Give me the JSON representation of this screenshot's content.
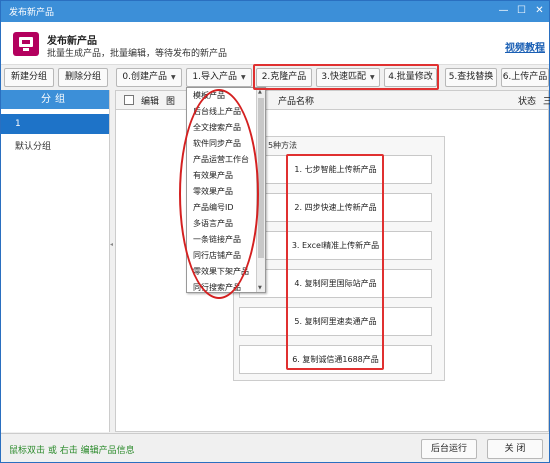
{
  "window": {
    "title": "发布新产品",
    "min_glyph": "—",
    "max_glyph": "☐",
    "close_glyph": "✕"
  },
  "header": {
    "title": "发布新产品",
    "subtitle": "批量生成产品，批量编辑，等待发布的新产品",
    "tutorial_link": "视频教程",
    "icon": "monitor-icon"
  },
  "toolbar": {
    "new_group": "新建分组",
    "delete_group": "删除分组",
    "create_product": "0.创建产品",
    "import_product": "1.导入产品",
    "clone_product": "2.克隆产品",
    "quick_match": "3.快速匹配",
    "batch_edit": "4.批量修改",
    "find_replace": "5.查找替换",
    "upload_product": "6.上传产品"
  },
  "groups": {
    "header": "分组",
    "items": [
      "1",
      "默认分组"
    ]
  },
  "grid": {
    "columns": [
      "编辑",
      "图",
      "产品名称",
      "状态",
      "三"
    ]
  },
  "methods": {
    "legend": "品 - 5种方法",
    "items": [
      "1. 七步智能上传新产品",
      "2. 四步快速上传新产品",
      "3. Excel精准上传新产品",
      "4. 复制阿里国际站产品",
      "5. 复制阿里速卖通产品",
      "6. 复制诚信通1688产品"
    ]
  },
  "dropdown": {
    "options": [
      "模板产品",
      "后台线上产品",
      "全文搜索产品",
      "软件同步产品",
      "产品运营工作台",
      "有效果产品",
      "零效果产品",
      "产品编号ID",
      "多语言产品",
      "一条链接产品",
      "同行店铺产品",
      "零效果下架产品",
      "同行搜索产品"
    ]
  },
  "status": {
    "hint": "鼠标双击 或 右击 编辑产品信息",
    "run_background": "后台运行",
    "close": "关 闭"
  },
  "colors": {
    "accent": "#3c8fd8",
    "selected": "#1e73c8",
    "annotation_red": "#e03030",
    "hint_green": "#2a8a2a",
    "brand_icon": "#b3005e"
  }
}
